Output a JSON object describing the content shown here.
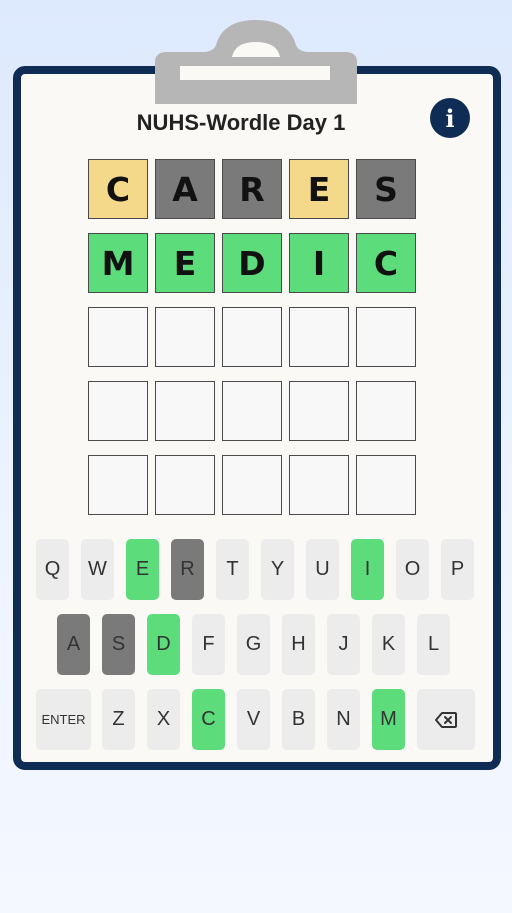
{
  "title": "NUHS-Wordle Day 1",
  "info_icon": "info-icon",
  "colors": {
    "present": "#f5d98a",
    "absent": "#7a7a7a",
    "correct": "#5ddc7c",
    "frame": "#0f2c55"
  },
  "grid": {
    "rows": [
      [
        {
          "letter": "C",
          "state": "present"
        },
        {
          "letter": "A",
          "state": "absent"
        },
        {
          "letter": "R",
          "state": "absent"
        },
        {
          "letter": "E",
          "state": "present"
        },
        {
          "letter": "S",
          "state": "absent"
        }
      ],
      [
        {
          "letter": "M",
          "state": "correct"
        },
        {
          "letter": "E",
          "state": "correct"
        },
        {
          "letter": "D",
          "state": "correct"
        },
        {
          "letter": "I",
          "state": "correct"
        },
        {
          "letter": "C",
          "state": "correct"
        }
      ],
      [
        {
          "letter": "",
          "state": "empty"
        },
        {
          "letter": "",
          "state": "empty"
        },
        {
          "letter": "",
          "state": "empty"
        },
        {
          "letter": "",
          "state": "empty"
        },
        {
          "letter": "",
          "state": "empty"
        }
      ],
      [
        {
          "letter": "",
          "state": "empty"
        },
        {
          "letter": "",
          "state": "empty"
        },
        {
          "letter": "",
          "state": "empty"
        },
        {
          "letter": "",
          "state": "empty"
        },
        {
          "letter": "",
          "state": "empty"
        }
      ],
      [
        {
          "letter": "",
          "state": "empty"
        },
        {
          "letter": "",
          "state": "empty"
        },
        {
          "letter": "",
          "state": "empty"
        },
        {
          "letter": "",
          "state": "empty"
        },
        {
          "letter": "",
          "state": "empty"
        }
      ]
    ]
  },
  "keyboard": {
    "row1": [
      {
        "label": "Q",
        "state": "default"
      },
      {
        "label": "W",
        "state": "default"
      },
      {
        "label": "E",
        "state": "correct"
      },
      {
        "label": "R",
        "state": "absent"
      },
      {
        "label": "T",
        "state": "default"
      },
      {
        "label": "Y",
        "state": "default"
      },
      {
        "label": "U",
        "state": "default"
      },
      {
        "label": "I",
        "state": "correct"
      },
      {
        "label": "O",
        "state": "default"
      },
      {
        "label": "P",
        "state": "default"
      }
    ],
    "row2": [
      {
        "label": "A",
        "state": "absent"
      },
      {
        "label": "S",
        "state": "absent"
      },
      {
        "label": "D",
        "state": "correct"
      },
      {
        "label": "F",
        "state": "default"
      },
      {
        "label": "G",
        "state": "default"
      },
      {
        "label": "H",
        "state": "default"
      },
      {
        "label": "J",
        "state": "default"
      },
      {
        "label": "K",
        "state": "default"
      },
      {
        "label": "L",
        "state": "default"
      }
    ],
    "row3": [
      {
        "label": "ENTER",
        "state": "default",
        "kind": "enter"
      },
      {
        "label": "Z",
        "state": "default"
      },
      {
        "label": "X",
        "state": "default"
      },
      {
        "label": "C",
        "state": "correct"
      },
      {
        "label": "V",
        "state": "default"
      },
      {
        "label": "B",
        "state": "default"
      },
      {
        "label": "N",
        "state": "default"
      },
      {
        "label": "M",
        "state": "correct"
      },
      {
        "label": "",
        "state": "default",
        "kind": "backspace",
        "icon": "backspace-icon"
      }
    ]
  }
}
